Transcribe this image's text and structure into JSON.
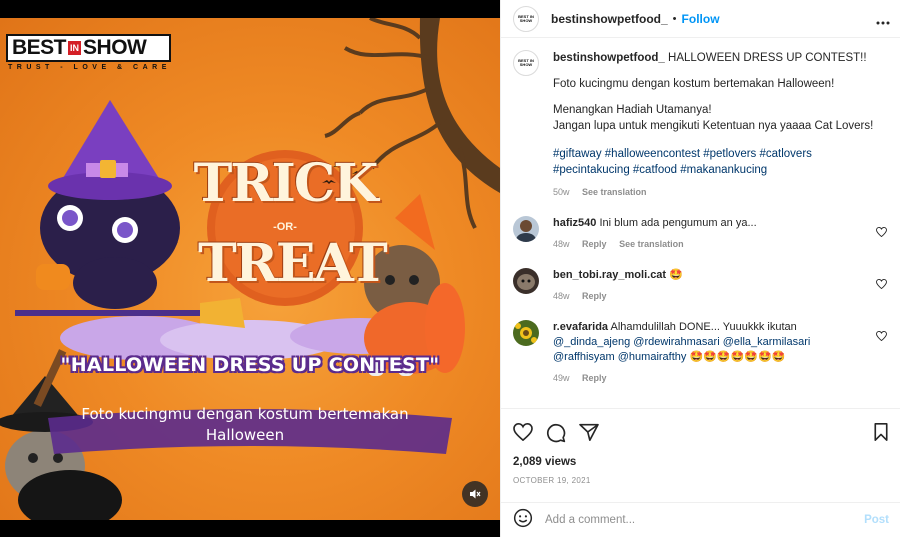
{
  "media": {
    "brand_name_left": "BEST",
    "brand_name_in": "IN",
    "brand_name_right": "SHOW",
    "brand_tagline": "TRUST - LOVE & CARE",
    "title_line1": "TRICK",
    "title_or": "-OR-",
    "title_line2": "TREAT",
    "contest_banner": "\"HALLOWEEN DRESS UP CONTEST\"",
    "subtitle": "Foto kucingmu dengan kostum bertemakan Halloween",
    "mute_icon": "speaker-muted-icon"
  },
  "header": {
    "avatar_text": "BEST IN SHOW",
    "username": "bestinshowpetfood_",
    "separator": "•",
    "follow_label": "Follow",
    "more_icon": "ellipsis-icon"
  },
  "caption": {
    "username": "bestinshowpetfood_",
    "title": "HALLOWEEN DRESS UP CONTEST!!",
    "line1": "Foto kucingmu dengan kostum bertemakan Halloween!",
    "line2": "Menangkan Hadiah Utamanya!",
    "line3": "Jangan lupa untuk mengikuti Ketentuan nya yaaaa Cat Lovers!",
    "hashtags_line1": "#giftaway #halloweencontest #petlovers #catlovers",
    "hashtags_line2": "#pecintakucing #catfood #makanankucing",
    "age": "50w",
    "see_translation": "See translation"
  },
  "comments": [
    {
      "username": "hafiz540",
      "text": "Ini blum ada pengumum an ya...",
      "age": "48w",
      "reply": "Reply",
      "see_translation": "See translation"
    },
    {
      "username": "ben_tobi.ray_moli.cat",
      "text": "🤩",
      "age": "48w",
      "reply": "Reply"
    },
    {
      "username": "r.evafarida",
      "text": "Alhamdulillah DONE... Yuuukkk ikutan",
      "mention1": "@_dinda_ajeng",
      "mention2": "@rdewirahmasari",
      "mention3": "@ella_karmilasari",
      "mention4": "@raffhisyam",
      "mention5": "@humairafthy",
      "emojis": "🤩🤩🤩🤩🤩🤩🤩",
      "age": "49w",
      "reply": "Reply"
    }
  ],
  "stats": {
    "views": "2,089 views",
    "date": "OCTOBER 19, 2021"
  },
  "add_comment": {
    "placeholder": "Add a comment...",
    "post_label": "Post"
  },
  "colors": {
    "accent": "#0095f6",
    "link": "#00376b",
    "muted": "#8e8e8e",
    "poster_orange": "#ef8a25",
    "banner_purple": "#5b2b8d"
  }
}
